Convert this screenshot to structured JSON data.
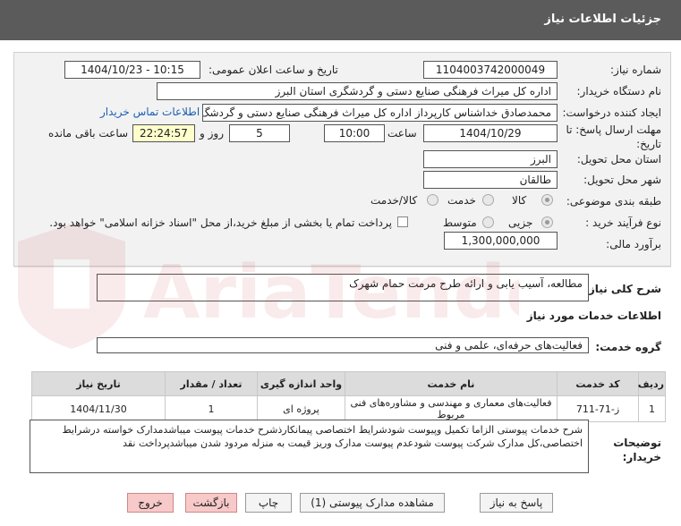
{
  "header": {
    "title": "جزئیات اطلاعات نیاز"
  },
  "form": {
    "need_number_label": "شماره نیاز:",
    "need_number": "1104003742000049",
    "announce_label": "تاریخ و ساعت اعلان عمومی:",
    "announce_value": "1404/10/23 - 10:15",
    "buyer_org_label": "نام دستگاه خریدار:",
    "buyer_org": "اداره کل میراث فرهنگی  صنایع دستی و گردشگری استان البرز",
    "creator_label": "ایجاد کننده درخواست:",
    "creator": "محمدصادق خداشناس  کارپرداز اداره کل میراث فرهنگی  صنایع دستی و گردشگ",
    "contact_link": "اطلاعات تماس خریدار",
    "deadline_label": "مهلت ارسال پاسخ: تا تاریخ:",
    "deadline_date": "1404/10/29",
    "time_label": "ساعت",
    "deadline_time": "10:00",
    "days_value": "5",
    "days_label": "روز و",
    "remaining_time": "22:24:57",
    "remaining_label": "ساعت باقی مانده",
    "province_label": "استان محل تحویل:",
    "province": "البرز",
    "city_label": "شهر محل تحویل:",
    "city": "طالقان",
    "category_label": "طبقه بندی موضوعی:",
    "category_options": [
      "کالا",
      "خدمت",
      "کالا/خدمت"
    ],
    "process_label": "نوع فرآیند خرید :",
    "process_options": [
      "جزیی",
      "متوسط"
    ],
    "payment_note": "پرداخت تمام یا بخشی از مبلغ خرید،از محل \"اسناد خزانه اسلامی\" خواهد بود.",
    "budget_label": "برآورد مالی:",
    "budget": "1,300,000,000"
  },
  "description": {
    "label": "شرح کلی نیاز:",
    "text": "مطالعه، آسیب یابی  و ارائه طرح مرمت حمام شهرک"
  },
  "services": {
    "section_title": "اطلاعات خدمات مورد نیاز",
    "group_label": "گروه خدمت:",
    "group_value": "فعالیت‌های حرفه‌ای، علمی و فنی",
    "columns": [
      "ردیف",
      "کد خدمت",
      "نام خدمت",
      "واحد اندازه گیری",
      "تعداد / مقدار",
      "تاریخ نیاز"
    ],
    "rows": [
      [
        "1",
        "ز-71-711",
        "فعالیت‌های معماری و مهندسی و مشاوره‌های فنی مربوط",
        "پروژه ای",
        "1",
        "1404/11/30"
      ]
    ]
  },
  "buyer_notes": {
    "label": "توضیحات خریدار:",
    "text": "شرح خدمات پیوستی الزاما تکمیل وپیوست شودشرایط اختصاصی پیمانکارذشرح خدمات پیوست میباشدمدارک خواسته درشرایط اختصاصی،کل مدارک شرکت پیوست شودعدم پیوست مدارک وریز قیمت به منزله مردود شدن میباشدپرداخت نقد"
  },
  "buttons": {
    "reply": "پاسخ به نیاز",
    "attachments": "مشاهده مدارک پیوستی (1)",
    "print": "چاپ",
    "back": "بازگشت",
    "exit": "خروج"
  },
  "watermark": {
    "text": "AriaTender.neT"
  }
}
